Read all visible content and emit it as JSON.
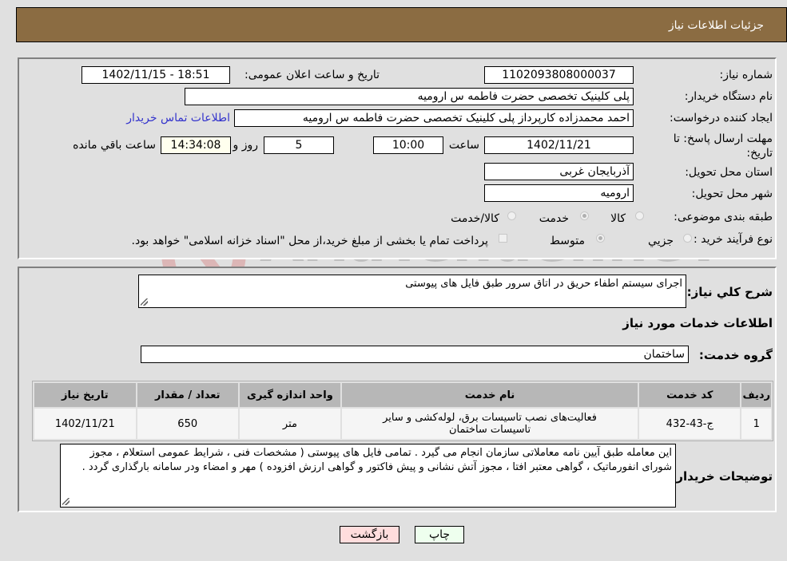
{
  "header": {
    "title": "جزئیات اطلاعات نیاز"
  },
  "form": {
    "need_number_label": "شماره نیاز:",
    "need_number": "1102093808000037",
    "announce_label": "تاریخ و ساعت اعلان عمومی:",
    "announce_value": "1402/11/15 - 18:51",
    "buyer_org_label": "نام دستگاه خریدار:",
    "buyer_org": "پلی کلینیک تخصصی حضرت فاطمه  س  ارومیه",
    "creator_label": "ایجاد کننده درخواست:",
    "creator": "احمد محمدزاده کارپرداز پلی کلینیک تخصصی حضرت فاطمه  س  ارومیه",
    "contact_link": "اطلاعات تماس خریدار",
    "deadline_label": "مهلت ارسال پاسخ: تا تاریخ:",
    "deadline_date": "1402/11/21",
    "time_label": "ساعت",
    "deadline_time": "10:00",
    "days": "5",
    "days_label": "روز و",
    "remaining_time": "14:34:08",
    "remaining_label": "ساعت باقي مانده",
    "province_label": "استان محل تحویل:",
    "province": "آذربایجان غربی",
    "city_label": "شهر محل تحویل:",
    "city": "ارومیه",
    "category_label": "طبقه بندی موضوعی:",
    "category_options": [
      "کالا",
      "خدمت",
      "کالا/خدمت"
    ],
    "category_selected": "خدمت",
    "purchase_type_label": "نوع فرآیند خرید :",
    "purchase_options": [
      "جزيي",
      "متوسط"
    ],
    "purchase_selected": "متوسط",
    "treasury_note": "پرداخت تمام یا بخشی از مبلغ خرید،از محل \"اسناد خزانه اسلامی\" خواهد بود."
  },
  "details": {
    "description_label": "شرح کلي نیاز:",
    "description": "اجرای سیستم اطفاء حریق در اتاق سرور طبق فایل های پیوستی",
    "services_heading": "اطلاعات خدمات مورد نیاز",
    "service_group_label": "گروه خدمت:",
    "service_group": "ساختمان",
    "table": {
      "headers": [
        "ردیف",
        "کد خدمت",
        "نام خدمت",
        "واحد اندازه گیری",
        "تعداد / مقدار",
        "تاریخ نیاز"
      ],
      "rows": [
        [
          "1",
          "ج-43-432",
          "فعالیت‌های نصب تاسیسات برق، لوله‌کشی و سایر تاسیسات ساختمان",
          "متر",
          "650",
          "1402/11/21"
        ]
      ]
    },
    "buyer_notes_label": "توضیحات خریدار:",
    "buyer_notes": "این معامله طبق آیین نامه معاملاتی سازمان انجام می گیرد . تمامی فایل های پیوستی ( مشخصات فنی ، شرایط عمومی استعلام ، مجوز شورای انفورماتیک ، گواهی معتبر افتا ، مجوز آتش نشانی و پیش فاکتور و گواهی ارزش افزوده ) مهر و امضاء ودر سامانه بارگذاری گردد ."
  },
  "buttons": {
    "print": "چاپ",
    "back": "بازگشت"
  },
  "watermark": {
    "text": "AriaTender.neT"
  },
  "colors": {
    "header": "#8b6c42",
    "back_button": "#ffdddd",
    "print_button": "#eeffee",
    "link": "#3333cc"
  }
}
